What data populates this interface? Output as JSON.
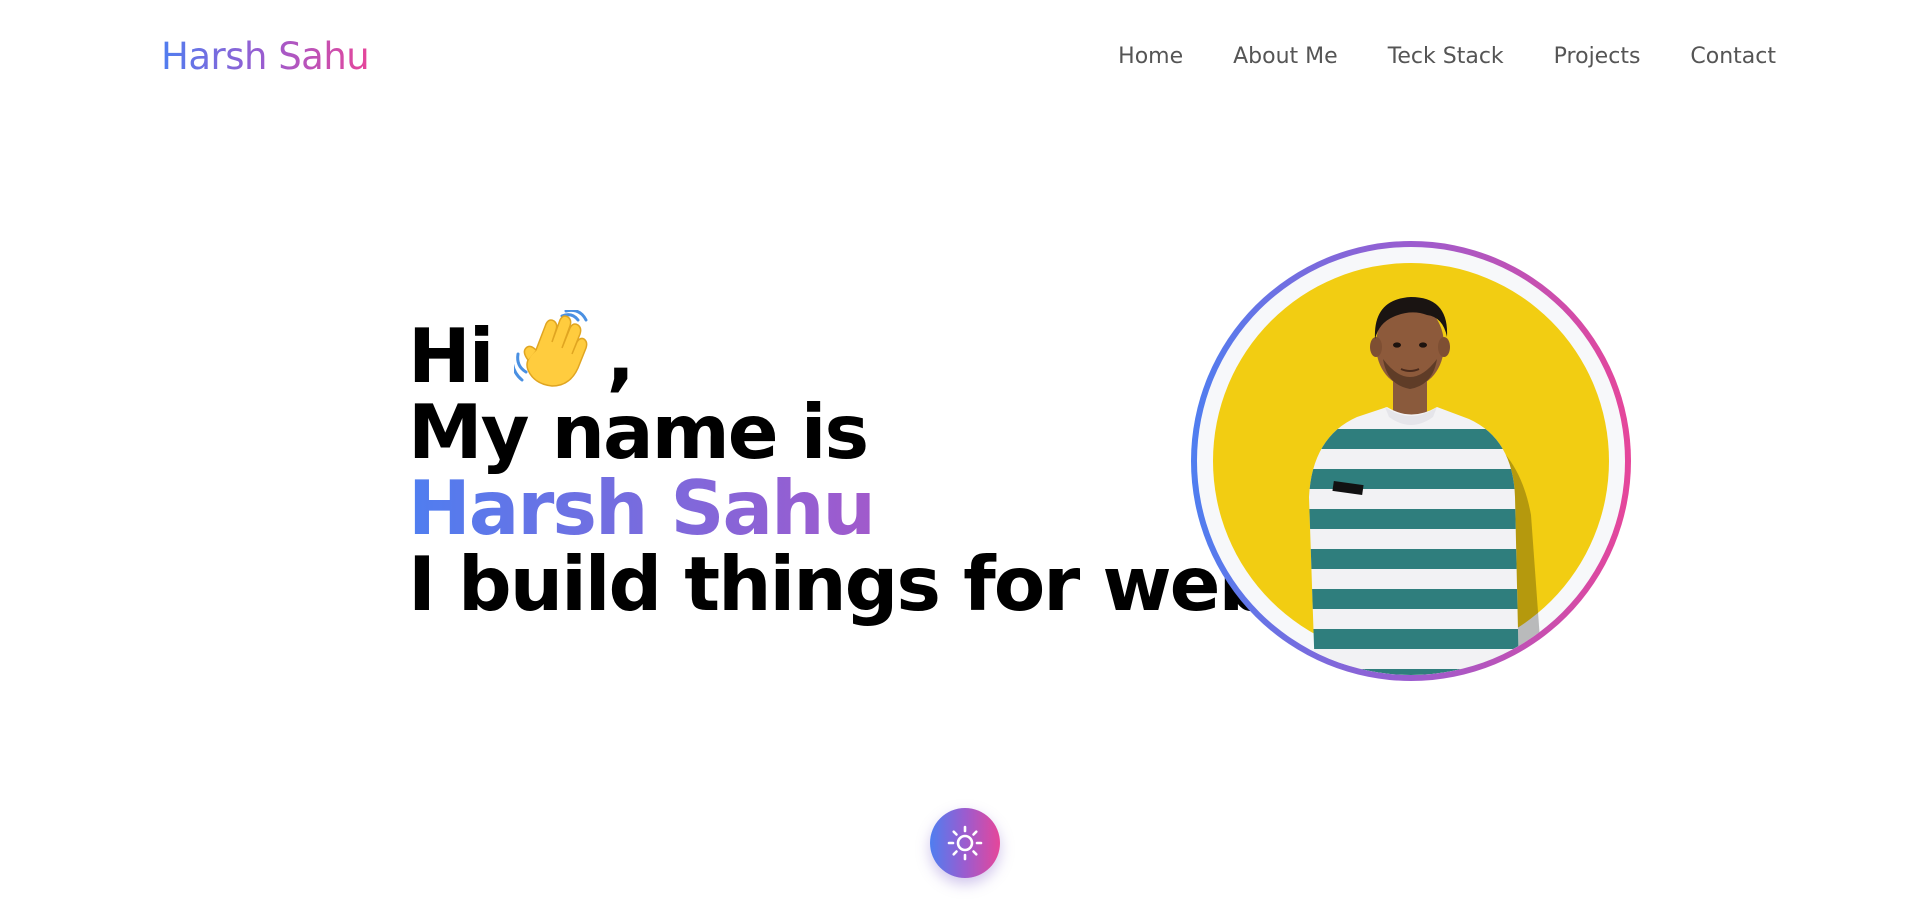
{
  "header": {
    "brand": "Harsh Sahu",
    "nav": [
      {
        "label": "Home"
      },
      {
        "label": "About Me"
      },
      {
        "label": "Teck Stack"
      },
      {
        "label": "Projects"
      },
      {
        "label": "Contact"
      }
    ]
  },
  "hero": {
    "greeting": "Hi",
    "greeting_suffix": ",",
    "greeting_icon": "waving-hand-icon",
    "line2": "My name is",
    "name": "Harsh Sahu",
    "tagline": "I build things for web"
  },
  "profile": {
    "image": "profile-photo",
    "ring_gradient": [
      "#4f7ef0",
      "#9b5ccf",
      "#e6469a"
    ],
    "background_color": "#f2cd12"
  },
  "theme_toggle": {
    "icon": "sun-icon"
  },
  "colors": {
    "brand_gradient": [
      "#4f7ef0",
      "#9b5ccf",
      "#e6469a"
    ],
    "nav_text": "#555555",
    "hero_text": "#000000"
  }
}
